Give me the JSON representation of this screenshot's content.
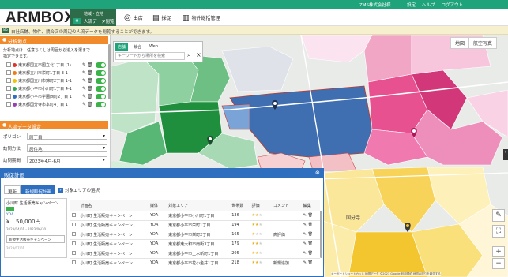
{
  "topbar": {
    "company": "ZMS株式会社様",
    "links": [
      "設定",
      "ヘルプ",
      "ログアウト"
    ]
  },
  "header": {
    "logo": "ARMBOX",
    "nav_active": {
      "line1": "地域・立地",
      "line2": "人流データ閲覧"
    },
    "nav_items": [
      "出店",
      "採促",
      "物件総括管理"
    ]
  },
  "infobar": {
    "badge": "85",
    "text": "自社店舗、物件、競合店の周辺の人流データを閲覧することができます。"
  },
  "sidebar": {
    "analysis_title": "分析地点",
    "analysis_desc_1": "分析地点は、任意ちくしは周囲から追入を選まで",
    "analysis_desc_2": "指定できます。",
    "points": [
      {
        "label": "東京都国立市国立北1丁目 (1)",
        "color": "#e0342a"
      },
      {
        "label": "東京都立川市栄町1丁目 3-1",
        "color": "#f07c12"
      },
      {
        "label": "東京都国立川市錦町2丁目 1-1",
        "color": "#f2c300"
      },
      {
        "label": "東京都小平市小川町1丁目 4-1",
        "color": "#2fa84f"
      },
      {
        "label": "東京都小平市学園西町2丁目 1",
        "color": "#2f6fc0"
      },
      {
        "label": "東京都国分寺市本町4丁目 1",
        "color": "#9b3fb5"
      }
    ],
    "people_title": "人流データ設定",
    "filters": [
      {
        "label": "ポリゴン",
        "value": "町丁目"
      },
      {
        "label": "訪問方法",
        "value": "居住地"
      },
      {
        "label": "訪問期間",
        "value": "2023年4月-6月"
      }
    ]
  },
  "map": {
    "tabs": [
      "店舗",
      "競合",
      "Web"
    ],
    "search_placeholder": "キーワードから場所を検索",
    "type_buttons": [
      "地図",
      "航空写真"
    ],
    "zoom_in": "+",
    "zoom_out": "−",
    "attribution": "キーボードショートカット 地図データ ©2023 Google 利用規約 地図の誤りを報告する",
    "place_label": "国分寺"
  },
  "panel": {
    "title": "販促計画",
    "tab_update": "更新",
    "tab_new": "新規販促計画",
    "checkbox_label": "対象エリアの選択",
    "card": {
      "title": "小川町 生活販売キャンペーン",
      "tag": "YDA",
      "price": "50,000円",
      "date_range": "2023/04/01 - 2023/06/30",
      "button": "新規生活販売キャンペーン",
      "footer": "2023/07/01"
    },
    "columns": [
      "",
      "計画名",
      "媒体",
      "対象エリア",
      "世帯数",
      "評価",
      "コメント",
      "編集"
    ],
    "rows": [
      {
        "name": "小川町 生活販売キャンペーン",
        "media": "YDA",
        "area": "東京都小平市小川町1丁目",
        "households": "136",
        "rating": 2,
        "comment": ""
      },
      {
        "name": "小川町 生活販売キャンペーン",
        "media": "YDA",
        "area": "東京都小平市栄町1丁目",
        "households": "194",
        "rating": 2,
        "comment": ""
      },
      {
        "name": "小川町 生活販売キャンペーン",
        "media": "YDA",
        "area": "東京都小平市栄町2丁目",
        "households": "165",
        "rating": 1,
        "comment": "高評価"
      },
      {
        "name": "小川町 生活販売キャンペーン",
        "media": "YDA",
        "area": "東京都東大和市南街3丁目",
        "households": "179",
        "rating": 2,
        "comment": ""
      },
      {
        "name": "小川町 生活販売キャンペーン",
        "media": "YDA",
        "area": "東京都小平市上水新町1丁目",
        "households": "205",
        "rating": 2,
        "comment": ""
      },
      {
        "name": "小川町 生活販売キャンペーン",
        "media": "YDA",
        "area": "東京都小平市花小金井1丁目",
        "households": "218",
        "rating": 2,
        "comment": "新規追加"
      }
    ]
  },
  "colors": {
    "brand": "#1fa37a",
    "accent_orange": "#f08a2b",
    "panel_blue": "#2f6fc0",
    "nav_dark": "#2d6b49"
  }
}
